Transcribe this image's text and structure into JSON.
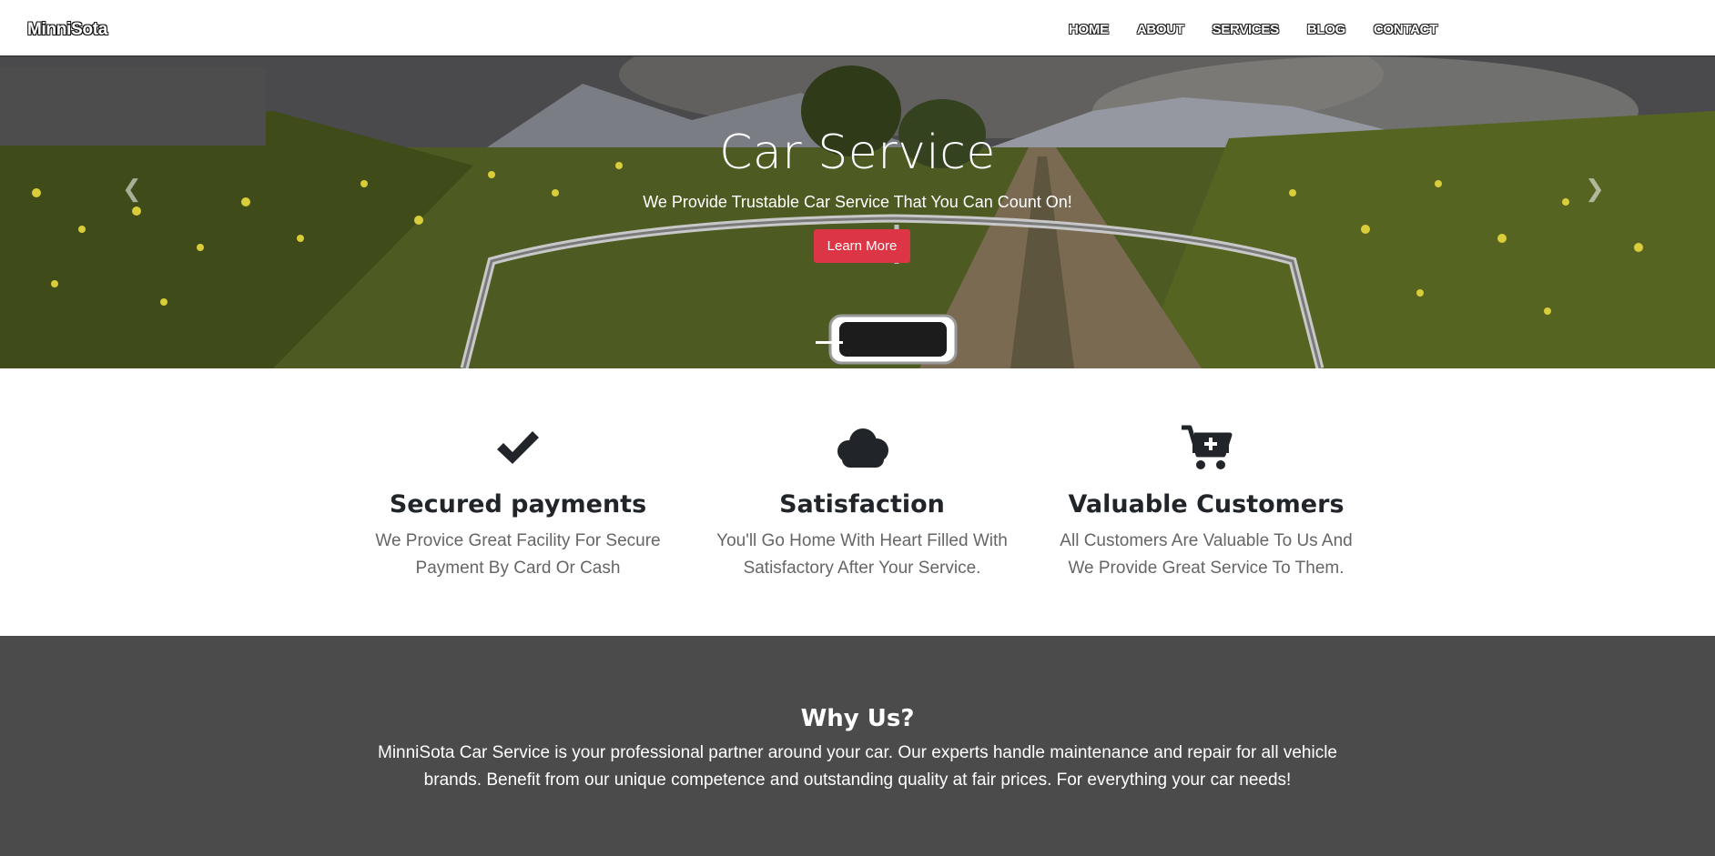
{
  "navbar": {
    "brand": "MinniSota",
    "links": [
      "HOME",
      "ABOUT",
      "SERVICES",
      "BLOG",
      "CONTACT"
    ]
  },
  "hero": {
    "title": "Car Service",
    "subtitle": "We Provide Trustable Car Service That You Can Count On!",
    "button_label": "Learn More",
    "prev_icon": "chevron-left-icon",
    "next_icon": "chevron-right-icon"
  },
  "features": [
    {
      "icon": "check-icon",
      "title": "Secured payments",
      "text": "We Provice Great Facility For Secure Payment By Card Or Cash"
    },
    {
      "icon": "cloud-icon",
      "title": "Satisfaction",
      "text": "You'll Go Home With Heart Filled With Satisfactory After Your Service."
    },
    {
      "icon": "cart-plus-icon",
      "title": "Valuable Customers",
      "text": "All Customers Are Valuable To Us And We Provide Great Service To Them."
    }
  ],
  "why_us": {
    "title": "Why Us?",
    "text": "MinniSota Car Service is your professional partner around your car. Our experts handle maintenance and repair for all vehicle brands. Benefit from our unique competence and outstanding quality at fair prices. For everything your car needs!"
  },
  "colors": {
    "accent": "#dc3545",
    "dark_section": "#4b4b4b",
    "text_dark": "#212529",
    "text_muted": "#666666"
  }
}
